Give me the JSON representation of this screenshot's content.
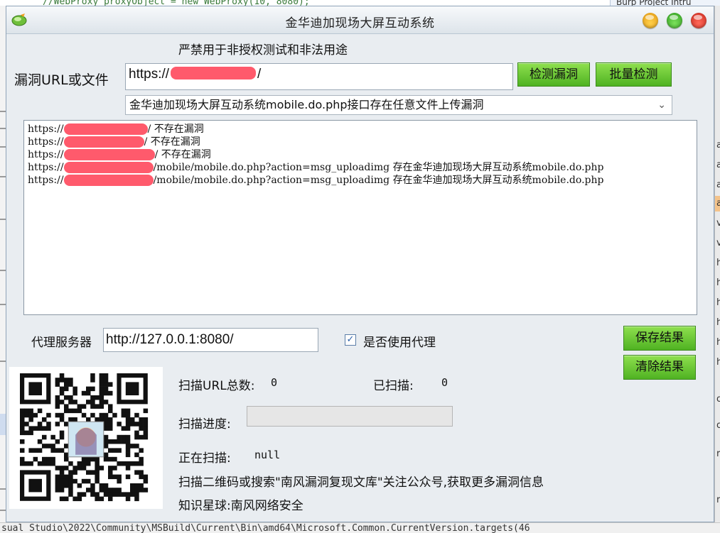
{
  "background": {
    "code_top": "//WebProxy proxyObject = new WebProxy(10, 8080);",
    "right_top": "Burp Project Intru",
    "right_strip_letters": [
      "a",
      "a",
      "a",
      "a",
      "v",
      "v",
      "h",
      "h",
      "h",
      "h",
      "h",
      "h",
      "o",
      "o",
      "r",
      "r"
    ],
    "bottom_path": "sual Studio\\2022\\Community\\MSBuild\\Current\\Bin\\amd64\\Microsoft.Common.CurrentVersion.targets(46"
  },
  "window": {
    "title": "金华迪加现场大屏互动系统",
    "warning": "严禁用于非授权测试和非法用途",
    "url_label": "漏洞URL或文件",
    "url_value": "https://",
    "url_suffix": "/",
    "btn_detect": "检测漏洞",
    "btn_batch": "批量检测",
    "select_value": "金华迪加现场大屏互动系统mobile.do.php接口存在任意文件上传漏洞",
    "results": [
      {
        "prefix": "https://",
        "suffix": "/  不存在漏洞"
      },
      {
        "prefix": "https://",
        "suffix": "/  不存在漏洞"
      },
      {
        "prefix": "https://",
        "suffix": "/  不存在漏洞"
      },
      {
        "prefix": "https://",
        "suffix": "/mobile/mobile.do.php?action=msg_uploadimg  存在金华迪加现场大屏互动系统mobile.do.php"
      },
      {
        "prefix": "https://",
        "suffix": "/mobile/mobile.do.php?action=msg_uploadimg  存在金华迪加现场大屏互动系统mobile.do.php"
      }
    ],
    "proxy_label": "代理服务器",
    "proxy_value": "http://127.0.0.1:8080/",
    "use_proxy_label": "是否使用代理",
    "use_proxy_checked": true,
    "btn_save": "保存结果",
    "btn_clear": "清除结果",
    "total_label": "扫描URL总数:",
    "total_value": "0",
    "scanned_label": "已扫描:",
    "scanned_value": "0",
    "progress_label": "扫描进度:",
    "progress_value": 0,
    "current_label": "正在扫描:",
    "current_value": "null",
    "promo_line": "扫描二维码或搜索\"南风漏洞复现文库\"关注公众号,获取更多漏洞信息",
    "planet_line": "知识星球:南风网络安全"
  },
  "colors": {
    "button_green": "#5cc02a",
    "redaction": "#ff5a6c",
    "window_bg": "#e9edf1"
  }
}
